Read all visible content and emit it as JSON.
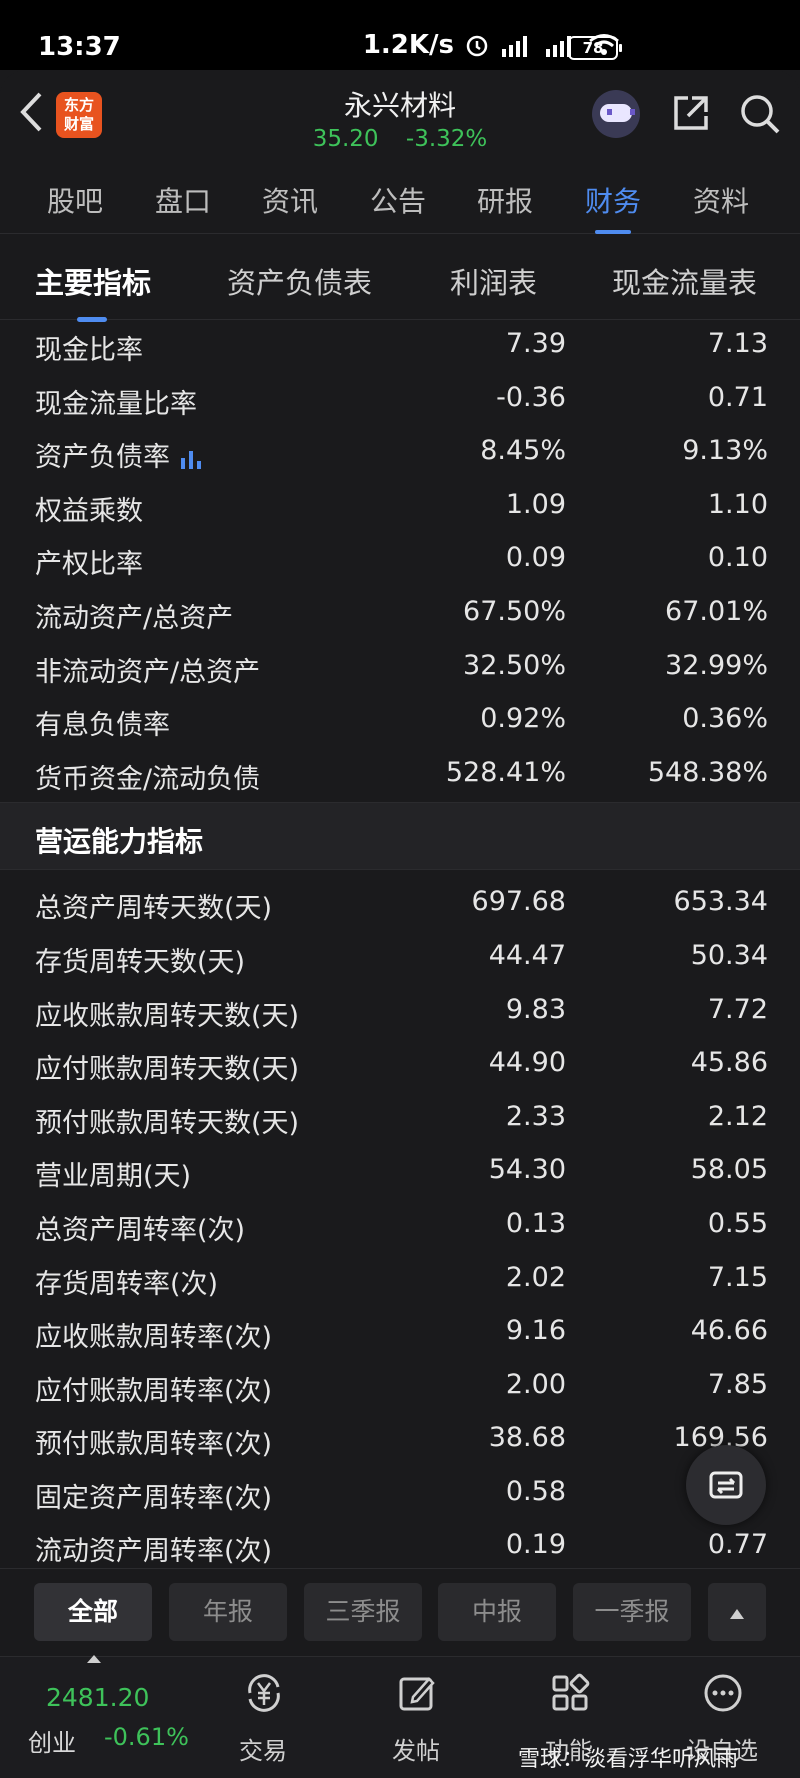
{
  "status_bar": {
    "time": "13:37",
    "net_speed": "1.2K/s",
    "battery": "78"
  },
  "header": {
    "logo_line1": "东方",
    "logo_line2": "财富",
    "stock_name": "永兴材料",
    "price": "35.20",
    "change": "-3.32%"
  },
  "main_tabs": [
    "股吧",
    "盘口",
    "资讯",
    "公告",
    "研报",
    "财务",
    "资料"
  ],
  "main_tab_active": "财务",
  "sub_tabs": [
    "主要指标",
    "资产负债表",
    "利润表",
    "现金流量表"
  ],
  "rows_top": [
    {
      "label": "现金比率",
      "v1": "7.39",
      "v2": "7.13"
    },
    {
      "label": "现金流量比率",
      "v1": "-0.36",
      "v2": "0.71"
    },
    {
      "label": "资产负债率",
      "v1": "8.45%",
      "v2": "9.13%"
    },
    {
      "label": "权益乘数",
      "v1": "1.09",
      "v2": "1.10"
    },
    {
      "label": "产权比率",
      "v1": "0.09",
      "v2": "0.10"
    },
    {
      "label": "流动资产/总资产",
      "v1": "67.50%",
      "v2": "67.01%"
    },
    {
      "label": "非流动资产/总资产",
      "v1": "32.50%",
      "v2": "32.99%"
    },
    {
      "label": "有息负债率",
      "v1": "0.92%",
      "v2": "0.36%"
    },
    {
      "label": "货币资金/流动负债",
      "v1": "528.41%",
      "v2": "548.38%"
    }
  ],
  "section_title": "营运能力指标",
  "rows_ops": [
    {
      "label": "总资产周转天数(天)",
      "v1": "697.68",
      "v2": "653.34"
    },
    {
      "label": "存货周转天数(天)",
      "v1": "44.47",
      "v2": "50.34"
    },
    {
      "label": "应收账款周转天数(天)",
      "v1": "9.83",
      "v2": "7.72"
    },
    {
      "label": "应付账款周转天数(天)",
      "v1": "44.90",
      "v2": "45.86"
    },
    {
      "label": "预付账款周转天数(天)",
      "v1": "2.33",
      "v2": "2.12"
    },
    {
      "label": "营业周期(天)",
      "v1": "54.30",
      "v2": "58.05"
    },
    {
      "label": "总资产周转率(次)",
      "v1": "0.13",
      "v2": "0.55"
    },
    {
      "label": "存货周转率(次)",
      "v1": "2.02",
      "v2": "7.15"
    },
    {
      "label": "应收账款周转率(次)",
      "v1": "9.16",
      "v2": "46.66"
    },
    {
      "label": "应付账款周转率(次)",
      "v1": "2.00",
      "v2": "7.85"
    },
    {
      "label": "预付账款周转率(次)",
      "v1": "38.68",
      "v2": "169.56"
    },
    {
      "label": "固定资产周转率(次)",
      "v1": "0.58",
      "v2": ""
    },
    {
      "label": "流动资产周转率(次)",
      "v1": "0.19",
      "v2": "0.77"
    }
  ],
  "filters": [
    "全部",
    "年报",
    "三季报",
    "中报",
    "一季报"
  ],
  "filter_active": "全部",
  "index": {
    "value": "2481.20",
    "name": "创业",
    "change": "-0.61%"
  },
  "nav": [
    "交易",
    "发帖",
    "功能",
    "设自选"
  ],
  "watermark": "雪球：淡看浮华听风雨",
  "colors": {
    "up_accent": "#4f8cf0",
    "down_green": "#3ec25a",
    "background": "#1a1a1c"
  }
}
